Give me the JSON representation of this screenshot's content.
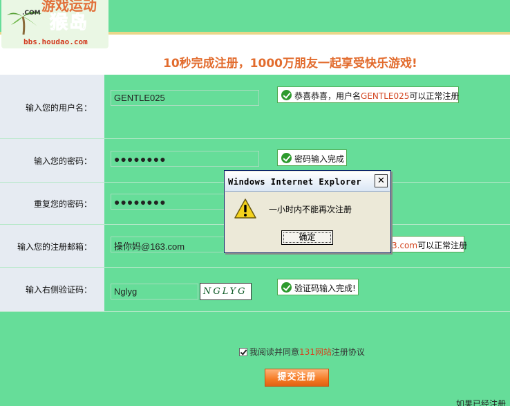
{
  "logo": {
    "top_text": "游戏运动",
    "com": ".COM",
    "brand": "猴岛",
    "url": "bbs.houdao.com"
  },
  "slogan": "10秒完成注册，1000万朋友一起享受快乐游戏!",
  "form": {
    "username": {
      "label": "输入您的用户名：",
      "value": "GENTLE025",
      "msg_prefix": "恭喜恭喜，用户名",
      "msg_highlight": "GENTLE025",
      "msg_suffix": "可以正常注册"
    },
    "password": {
      "label": "输入您的密码：",
      "value": "●●●●●●●●",
      "msg": "密码输入完成"
    },
    "password_repeat": {
      "label": "重复您的密码：",
      "value": "●●●●●●●●"
    },
    "email": {
      "label": "输入您的注册邮箱：",
      "value": "操你妈@163.com",
      "msg_highlight": "3.com",
      "msg_suffix": "可以正常注册"
    },
    "captcha": {
      "label": "输入右侧验证码：",
      "value": "Nglyg",
      "image_text": "NGLYG",
      "msg": "验证码输入完成!"
    }
  },
  "agreement": {
    "checked": true,
    "text_prefix": "我阅读并同意",
    "site": "131网站",
    "text_suffix": "注册协议"
  },
  "submit_label": "提交注册",
  "login_hint": "如果已经注册",
  "dialog": {
    "title": "Windows Internet Explorer",
    "close": "✕",
    "message": "一小时内不能再次注册",
    "ok_label": "确定"
  },
  "colors": {
    "page_bg": "#66dd99",
    "label_bg": "#e6ebf2",
    "accent_orange": "#e26c2e",
    "ok_green": "#2d9a2d"
  }
}
